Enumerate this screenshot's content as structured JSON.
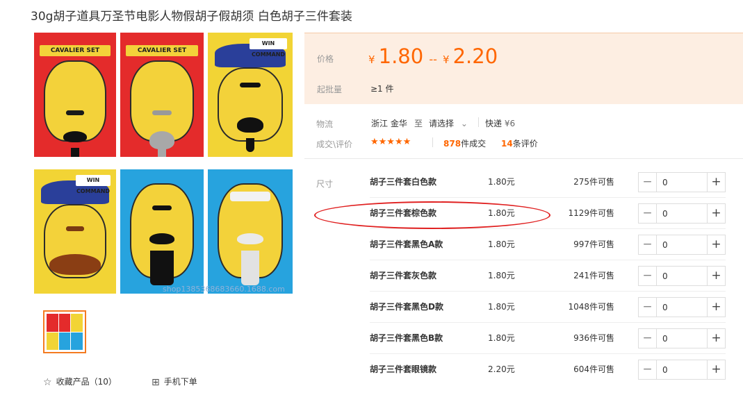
{
  "title": "30g胡子道具万圣节电影人物假胡子假胡须 白色胡子三件套装",
  "image": {
    "panel1_banner": "CAVALIER SET",
    "panel2_banner": "CAVALIER SET",
    "panel3_banner": "WIN COMMAND",
    "panel4_banner": "WIN COMMAND",
    "watermark": "shop1385368683660.1688.com",
    "colors": {
      "red": "#e42b2b",
      "yellow": "#f2d435",
      "blue": "#27a3de"
    }
  },
  "price": {
    "label": "价格",
    "currency": "¥",
    "low": "1.80",
    "dash": "--",
    "high": "2.20"
  },
  "moq": {
    "label": "起批量",
    "value": "≥1 件"
  },
  "logistics": {
    "label": "物流",
    "origin": "浙江 金华",
    "to": "至",
    "select": "请选择",
    "express_label": "快递",
    "express_price": "¥6"
  },
  "rating": {
    "label": "成交\\评价",
    "stars": "★★★★★",
    "deals_count": "878",
    "deals_text": "件成交",
    "reviews_count": "14",
    "reviews_text": "条评价"
  },
  "sku": {
    "label": "尺寸",
    "rows": [
      {
        "name": "胡子三件套白色款",
        "price": "1.80元",
        "stock": "275件可售",
        "qty": "0"
      },
      {
        "name": "胡子三件套棕色款",
        "price": "1.80元",
        "stock": "1129件可售",
        "qty": "0"
      },
      {
        "name": "胡子三件套黑色A款",
        "price": "1.80元",
        "stock": "997件可售",
        "qty": "0"
      },
      {
        "name": "胡子三件套灰色款",
        "price": "1.80元",
        "stock": "241件可售",
        "qty": "0"
      },
      {
        "name": "胡子三件套黑色D款",
        "price": "1.80元",
        "stock": "1048件可售",
        "qty": "0"
      },
      {
        "name": "胡子三件套黑色B款",
        "price": "1.80元",
        "stock": "936件可售",
        "qty": "0"
      },
      {
        "name": "胡子三件套眼镜款",
        "price": "2.20元",
        "stock": "604件可售",
        "qty": "0"
      }
    ],
    "minus": "−",
    "plus": "+"
  },
  "actions": {
    "favorite_label": "收藏产品（10）",
    "favorite_icon": "star-outline-icon",
    "mobile_label": "手机下单",
    "mobile_icon": "qr-code-icon"
  },
  "accent_color": "#ff6600"
}
